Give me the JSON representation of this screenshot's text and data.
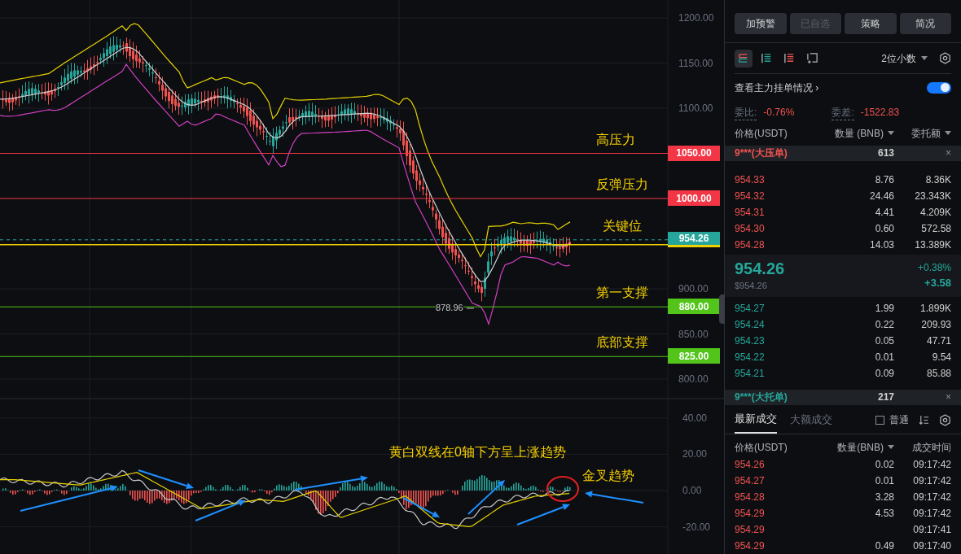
{
  "chart": {
    "price_ticks": [
      "1200.00",
      "1150.00",
      "1100.00",
      "900.00",
      "850.00",
      "800.00"
    ],
    "levels": [
      {
        "label": "高压力",
        "tag": "1050.00",
        "color": "#f23645",
        "kind": "line"
      },
      {
        "label": "反弹压力",
        "tag": "1000.00",
        "color": "#f23645",
        "kind": "line"
      },
      {
        "label": "关键位",
        "tag": "954.26",
        "color": "#26a69a",
        "kind": "current"
      },
      {
        "label": "第一支撑",
        "tag": "880.00",
        "color": "#52c41a",
        "kind": "line"
      },
      {
        "label": "底部支撑",
        "tag": "825.00",
        "color": "#52c41a",
        "kind": "line"
      }
    ],
    "low_label": "878.96",
    "macd_ticks": [
      "40.00",
      "20.00",
      "0.00",
      "-20.00"
    ],
    "macd_note": "黄白双线在0轴下方呈上涨趋势",
    "cross_note": "金叉趋势"
  },
  "panel": {
    "buttons": [
      {
        "label": "加预警",
        "disabled": false
      },
      {
        "label": "已自选",
        "disabled": true
      },
      {
        "label": "策略",
        "disabled": false
      },
      {
        "label": "简况",
        "disabled": false
      }
    ],
    "view_modes": [
      {
        "selected": true
      },
      {
        "selected": false
      },
      {
        "selected": false
      },
      {
        "selected": false
      }
    ],
    "precision": "2位小数",
    "main_orders": {
      "label": "查看主力挂单情况",
      "chevron": "›",
      "on": true
    },
    "ratio": {
      "label": "委比:",
      "value": "-0.76%"
    },
    "diff": {
      "label": "委差:",
      "value": "-1522.83"
    },
    "columns": [
      "价格(USDT)",
      "数量 (BNB)",
      "委托额"
    ],
    "ask_banner": {
      "label": "9***(大压单)",
      "value": "613",
      "close": "×"
    },
    "asks": [
      {
        "price": "954.33",
        "qty": "8.76",
        "total": "8.36K"
      },
      {
        "price": "954.32",
        "qty": "24.46",
        "total": "23.343K"
      },
      {
        "price": "954.31",
        "qty": "4.41",
        "total": "4.209K"
      },
      {
        "price": "954.30",
        "qty": "0.60",
        "total": "572.58"
      },
      {
        "price": "954.28",
        "qty": "14.03",
        "total": "13.389K"
      }
    ],
    "last": {
      "price": "954.26",
      "usd": "$954.26",
      "pct": "+0.38%",
      "change": "+3.58"
    },
    "bids": [
      {
        "price": "954.27",
        "qty": "1.99",
        "total": "1.899K"
      },
      {
        "price": "954.24",
        "qty": "0.22",
        "total": "209.93"
      },
      {
        "price": "954.23",
        "qty": "0.05",
        "total": "47.71"
      },
      {
        "price": "954.22",
        "qty": "0.01",
        "total": "9.54"
      },
      {
        "price": "954.21",
        "qty": "0.09",
        "total": "85.88"
      }
    ],
    "bid_banner": {
      "label": "9***(大托单)",
      "value": "217",
      "close": "×"
    },
    "trade_tabs": [
      {
        "label": "最新成交",
        "selected": true
      },
      {
        "label": "大额成交",
        "selected": false
      }
    ],
    "normal": {
      "label": "普通",
      "checked": false
    },
    "trade_columns": [
      "价格(USDT)",
      "数量(BNB)",
      "成交时间"
    ],
    "trades": [
      {
        "price": "954.26",
        "qty": "0.02",
        "time": "09:17:42"
      },
      {
        "price": "954.27",
        "qty": "0.01",
        "time": "09:17:42"
      },
      {
        "price": "954.28",
        "qty": "3.28",
        "time": "09:17:42"
      },
      {
        "price": "954.29",
        "qty": "4.53",
        "time": "09:17:42"
      },
      {
        "price": "954.29",
        "time": "09:17:41"
      },
      {
        "price": "954.29",
        "qty": "0.49",
        "time": "09:17:40"
      }
    ]
  }
}
